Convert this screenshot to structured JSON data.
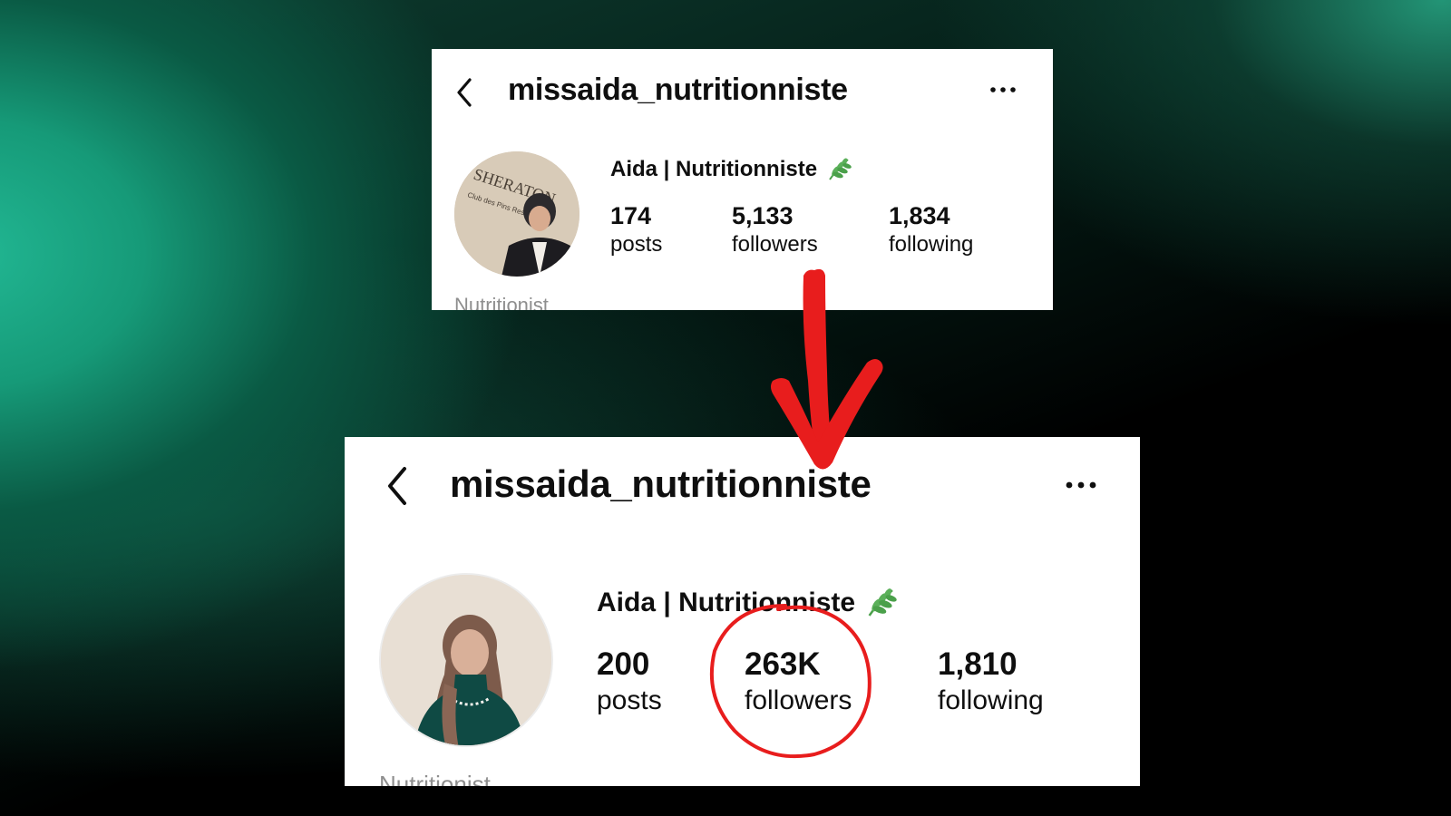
{
  "profile_before": {
    "username": "missaida_nutritionniste",
    "display_name": "Aida | Nutritionniste",
    "stats": [
      {
        "value": "174",
        "label": "posts"
      },
      {
        "value": "5,133",
        "label": "followers"
      },
      {
        "value": "1,834",
        "label": "following"
      }
    ],
    "bio_category": "Nutritionist",
    "avatar_backdrop_text": "SHERATON",
    "avatar_backdrop_subtext": "Club des Pins Resort"
  },
  "profile_after": {
    "username": "missaida_nutritionniste",
    "display_name": "Aida | Nutritionniste",
    "stats": [
      {
        "value": "200",
        "label": "posts"
      },
      {
        "value": "263K",
        "label": "followers"
      },
      {
        "value": "1,810",
        "label": "following"
      }
    ],
    "bio_category": "Nutritionist"
  },
  "icons": {
    "back": "chevron-left-icon",
    "more": "more-horizontal-icon",
    "badge": "leaf-icon"
  },
  "colors": {
    "annotation_red": "#e81d1d",
    "leaf_green": "#4aa04a",
    "bio_gray": "#8e8e8e"
  }
}
